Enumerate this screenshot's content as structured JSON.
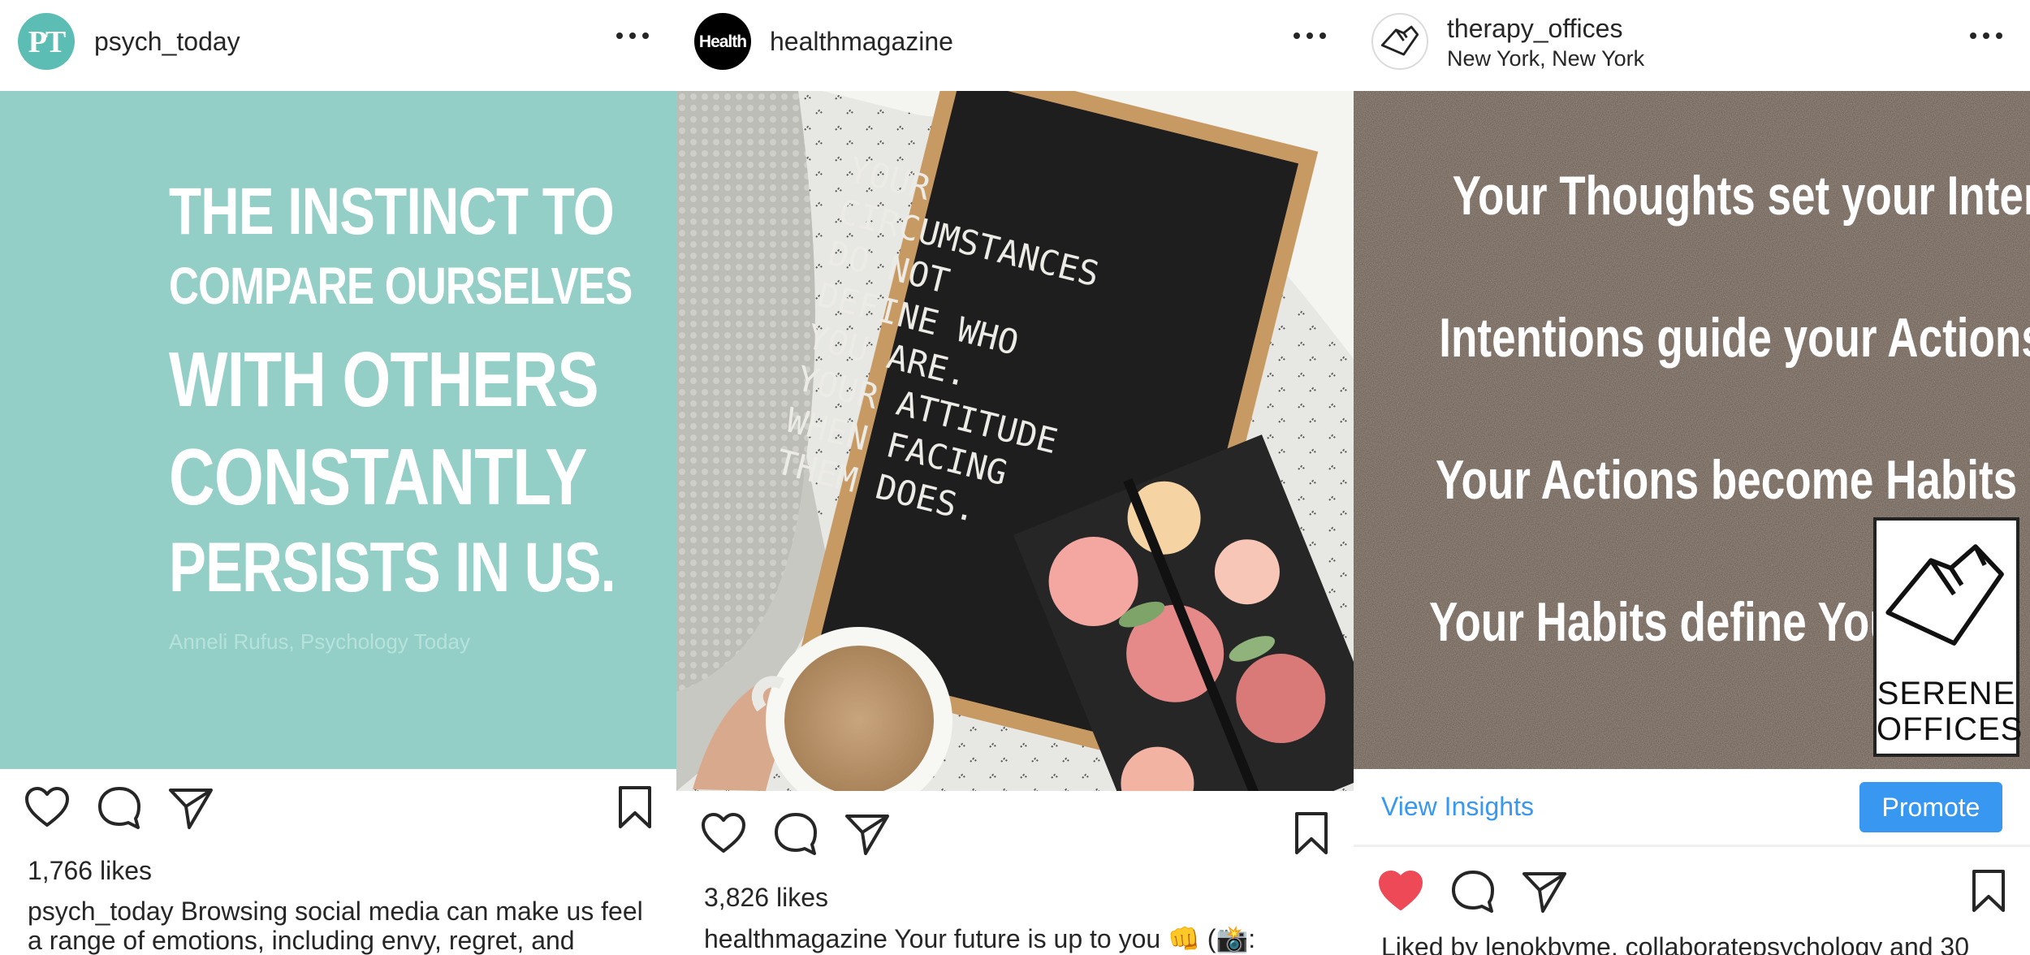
{
  "posts": [
    {
      "username": "psych_today",
      "avatar_text": "PT",
      "avatar_color": "#5bbdb3",
      "quote_lines": [
        "The instinct to",
        "compare ourselves",
        "with others",
        "constantly",
        "persists in us."
      ],
      "attribution": "Anneli Rufus, Psychology Today",
      "likes": "1,766 likes",
      "caption_user": "psych_today",
      "caption_text": "Browsing social media can make us feel a range of emotions, including envy, regret, and"
    },
    {
      "username": "healthmagazine",
      "avatar_text": "Health",
      "board_text": "YOUR\nCIRCUMSTANCES\nDO NOT\nDEFINE WHO\nYOU ARE.\nYOUR ATTITUDE\nWHEN FACING\nTHEM DOES.",
      "likes": "3,826 likes",
      "caption_user": "healthmagazine",
      "caption_text": "Your future is up to you 👊 (📸:"
    },
    {
      "username": "therapy_offices",
      "location": "New York, New York",
      "image_lines": [
        "Your Thoughts set your Intentions",
        "Intentions guide your Actions",
        "Your Actions become Habits",
        "Your Habits define You"
      ],
      "logo_lines": [
        "SERENE",
        "OFFICES"
      ],
      "view_insights": "View Insights",
      "promote": "Promote",
      "liked_by_prefix": "Liked by",
      "liked_by_users": "lenokbyme, collaboratepsychology",
      "liked_by_suffix": "and 30"
    }
  ],
  "colors": {
    "accent": "#3897f0",
    "liked_heart": "#ed4956",
    "quote_bg": "#93cfc6"
  },
  "icons": [
    "more-icon",
    "heart-icon",
    "comment-icon",
    "share-icon",
    "bookmark-icon"
  ]
}
